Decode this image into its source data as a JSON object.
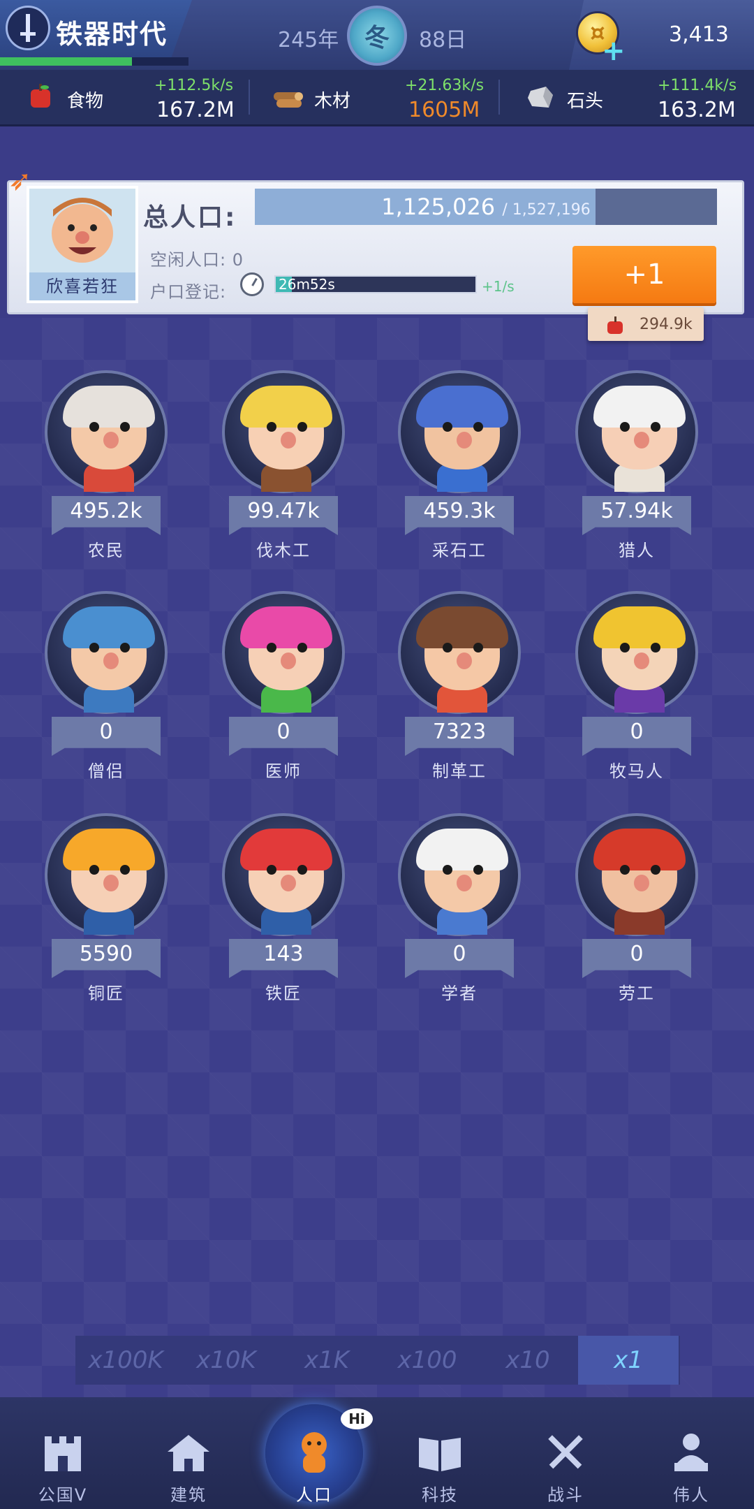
{
  "header": {
    "era_name": "铁器时代",
    "year": "245年",
    "season": "冬",
    "day": "88日",
    "coins": "3,413",
    "era_progress": 0.7
  },
  "resources": [
    {
      "icon": "apple-icon",
      "name": "食物",
      "rate": "+112.5k/s",
      "amount": "167.2M",
      "amount_color": "#ffffff"
    },
    {
      "icon": "wood-icon",
      "name": "木材",
      "rate": "+21.63k/s",
      "amount": "1605M",
      "amount_color": "#f08a2a"
    },
    {
      "icon": "stone-icon",
      "name": "石头",
      "rate": "+111.4k/s",
      "amount": "163.2M",
      "amount_color": "#ffffff"
    }
  ],
  "population": {
    "portrait_label": "欣喜若狂",
    "total_label": "总人口:",
    "current": "1,125,026",
    "max": "/ 1,527,196",
    "fill_fraction": 0.737,
    "idle": "空闲人口: 0",
    "register_label": "户口登记:",
    "register_timer": "26m52s",
    "register_fraction": 0.08,
    "register_rate": "+1/s",
    "add_button": "+1",
    "cost": "294.9k"
  },
  "workers": [
    {
      "name": "农民",
      "count": "495.2k",
      "skin": "#f4c9a8",
      "hair": "#e6e1dc",
      "body": "#d94a3a"
    },
    {
      "name": "伐木工",
      "count": "99.47k",
      "skin": "#f7d0b4",
      "hair": "#f2d04a",
      "body": "#8a5230"
    },
    {
      "name": "采石工",
      "count": "459.3k",
      "skin": "#f1c3a0",
      "hair": "#4a6fd0",
      "body": "#3a6fd0"
    },
    {
      "name": "猎人",
      "count": "57.94k",
      "skin": "#f6cfb6",
      "hair": "#f2f2f2",
      "body": "#e9e2d8"
    },
    {
      "name": "僧侣",
      "count": "0",
      "skin": "#f4c9a8",
      "hair": "#4a8fd0",
      "body": "#3d7ac0"
    },
    {
      "name": "医师",
      "count": "0",
      "skin": "#f6d0b6",
      "hair": "#e94aa8",
      "body": "#4ab84a"
    },
    {
      "name": "制革工",
      "count": "7323",
      "skin": "#f5c8a6",
      "hair": "#7a4a30",
      "body": "#e2553a"
    },
    {
      "name": "牧马人",
      "count": "0",
      "skin": "#f4d4b8",
      "hair": "#f0c430",
      "body": "#6a3aa8"
    },
    {
      "name": "铜匠",
      "count": "5590",
      "skin": "#f6d0b6",
      "hair": "#f7a82a",
      "body": "#2f5fa8"
    },
    {
      "name": "铁匠",
      "count": "143",
      "skin": "#f6d0b6",
      "hair": "#e23a3a",
      "body": "#2f5fa8"
    },
    {
      "name": "学者",
      "count": "0",
      "skin": "#f4c9a8",
      "hair": "#f2f2f2",
      "body": "#4a7ad0"
    },
    {
      "name": "劳工",
      "count": "0",
      "skin": "#f0c0a0",
      "hair": "#d63a2a",
      "body": "#8a3a2a"
    }
  ],
  "multipliers": [
    "x100K",
    "x10K",
    "x1K",
    "x100",
    "x10",
    "x1"
  ],
  "active_multiplier": "x1",
  "nav": [
    {
      "label": "公国V",
      "icon": "castle-icon"
    },
    {
      "label": "建筑",
      "icon": "house-icon"
    },
    {
      "label": "人口",
      "icon": "citizen-icon",
      "badge": "Hi"
    },
    {
      "label": "科技",
      "icon": "book-icon"
    },
    {
      "label": "战斗",
      "icon": "crossed-swords-icon"
    },
    {
      "label": "伟人",
      "icon": "bust-icon"
    }
  ]
}
